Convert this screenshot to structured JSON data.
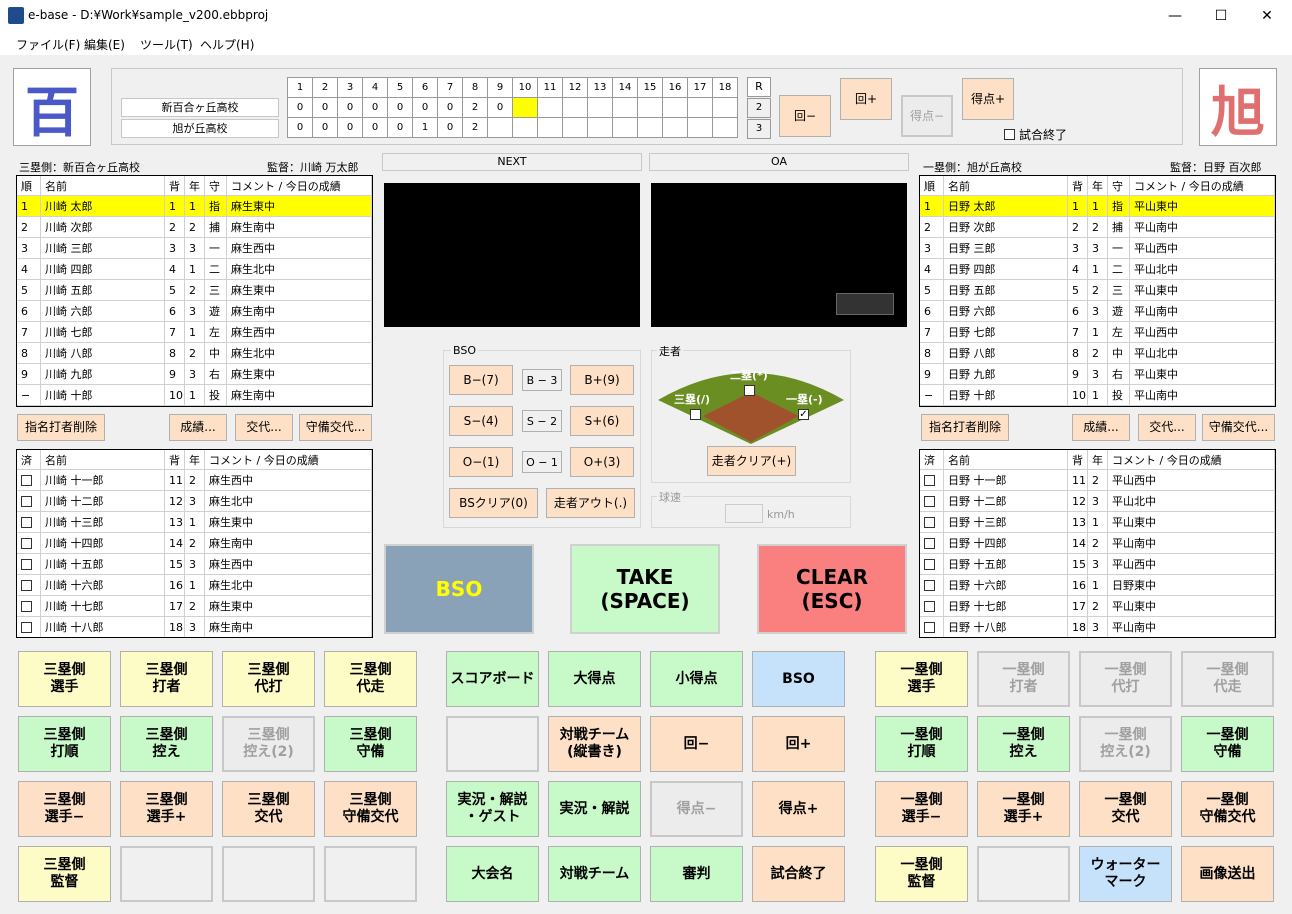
{
  "window": {
    "title": "e-base - D:¥Work¥sample_v200.ebbproj",
    "minimize": "—",
    "maximize": "☐",
    "close": "✕"
  },
  "menu": [
    "ファイル(F)",
    "編集(E)",
    "ツール(T)",
    "ヘルプ(H)"
  ],
  "logos": {
    "left": "百",
    "right": "旭",
    "left_color": "#4a58c8",
    "right_color": "#e07070"
  },
  "scoreboard": {
    "innings": [
      "1",
      "2",
      "3",
      "4",
      "5",
      "6",
      "7",
      "8",
      "9",
      "10",
      "11",
      "12",
      "13",
      "14",
      "15",
      "16",
      "17",
      "18"
    ],
    "r_label": "R",
    "teams": [
      {
        "name": "新百合ヶ丘高校",
        "scores": [
          "0",
          "0",
          "0",
          "0",
          "0",
          "0",
          "0",
          "2",
          "0",
          "",
          "",
          "",
          "",
          "",
          "",
          "",
          "",
          ""
        ],
        "r": "2"
      },
      {
        "name": "旭が丘高校",
        "scores": [
          "0",
          "0",
          "0",
          "0",
          "0",
          "1",
          "0",
          "2",
          "",
          "",
          "",
          "",
          "",
          "",
          "",
          "",
          "",
          ""
        ],
        "r": "3"
      }
    ],
    "current_cell": {
      "team": 0,
      "inning": 9
    },
    "btn_inning_minus": "回−",
    "btn_inning_plus": "回+",
    "btn_score_minus": "得点−",
    "btn_score_plus": "得点+",
    "game_end_label": "試合終了"
  },
  "left": {
    "side_label": "三塁側：新百合ヶ丘高校",
    "manager_label": "監督：川崎 万太郎",
    "headers": [
      "順",
      "名前",
      "背",
      "年",
      "守",
      "コメント / 今日の成績"
    ],
    "lineup": [
      [
        "1",
        "川崎 太郎",
        "1",
        "1",
        "指",
        "麻生東中"
      ],
      [
        "2",
        "川崎 次郎",
        "2",
        "2",
        "捕",
        "麻生南中"
      ],
      [
        "3",
        "川崎 三郎",
        "3",
        "3",
        "一",
        "麻生西中"
      ],
      [
        "4",
        "川崎 四郎",
        "4",
        "1",
        "二",
        "麻生北中"
      ],
      [
        "5",
        "川崎 五郎",
        "5",
        "2",
        "三",
        "麻生東中"
      ],
      [
        "6",
        "川崎 六郎",
        "6",
        "3",
        "遊",
        "麻生南中"
      ],
      [
        "7",
        "川崎 七郎",
        "7",
        "1",
        "左",
        "麻生西中"
      ],
      [
        "8",
        "川崎 八郎",
        "8",
        "2",
        "中",
        "麻生北中"
      ],
      [
        "9",
        "川崎 九郎",
        "9",
        "3",
        "右",
        "麻生東中"
      ],
      [
        "−",
        "川崎 十郎",
        "10",
        "1",
        "投",
        "麻生南中"
      ]
    ],
    "btn_dh": "指名打者削除",
    "btn_stats": "成績...",
    "btn_sub": "交代...",
    "btn_def": "守備交代...",
    "bench_headers": [
      "済",
      "名前",
      "背",
      "年",
      "コメント / 今日の成績"
    ],
    "bench": [
      [
        "川崎 十一郎",
        "11",
        "2",
        "麻生西中"
      ],
      [
        "川崎 十二郎",
        "12",
        "3",
        "麻生北中"
      ],
      [
        "川崎 十三郎",
        "13",
        "1",
        "麻生東中"
      ],
      [
        "川崎 十四郎",
        "14",
        "2",
        "麻生南中"
      ],
      [
        "川崎 十五郎",
        "15",
        "3",
        "麻生西中"
      ],
      [
        "川崎 十六郎",
        "16",
        "1",
        "麻生北中"
      ],
      [
        "川崎 十七郎",
        "17",
        "2",
        "麻生東中"
      ],
      [
        "川崎 十八郎",
        "18",
        "3",
        "麻生南中"
      ]
    ]
  },
  "right": {
    "side_label": "一塁側：旭が丘高校",
    "manager_label": "監督：日野 百次郎",
    "headers": [
      "順",
      "名前",
      "背",
      "年",
      "守",
      "コメント / 今日の成績"
    ],
    "lineup": [
      [
        "1",
        "日野 太郎",
        "1",
        "1",
        "指",
        "平山東中"
      ],
      [
        "2",
        "日野 次郎",
        "2",
        "2",
        "捕",
        "平山南中"
      ],
      [
        "3",
        "日野 三郎",
        "3",
        "3",
        "一",
        "平山西中"
      ],
      [
        "4",
        "日野 四郎",
        "4",
        "1",
        "二",
        "平山北中"
      ],
      [
        "5",
        "日野 五郎",
        "5",
        "2",
        "三",
        "平山東中"
      ],
      [
        "6",
        "日野 六郎",
        "6",
        "3",
        "遊",
        "平山南中"
      ],
      [
        "7",
        "日野 七郎",
        "7",
        "1",
        "左",
        "平山西中"
      ],
      [
        "8",
        "日野 八郎",
        "8",
        "2",
        "中",
        "平山北中"
      ],
      [
        "9",
        "日野 九郎",
        "9",
        "3",
        "右",
        "平山東中"
      ],
      [
        "−",
        "日野 十郎",
        "10",
        "1",
        "投",
        "平山南中"
      ]
    ],
    "btn_dh": "指名打者削除",
    "btn_stats": "成績...",
    "btn_sub": "交代...",
    "btn_def": "守備交代...",
    "bench_headers": [
      "済",
      "名前",
      "背",
      "年",
      "コメント / 今日の成績"
    ],
    "bench": [
      [
        "日野 十一郎",
        "11",
        "2",
        "平山西中"
      ],
      [
        "日野 十二郎",
        "12",
        "3",
        "平山北中"
      ],
      [
        "日野 十三郎",
        "13",
        "1",
        "平山東中"
      ],
      [
        "日野 十四郎",
        "14",
        "2",
        "平山南中"
      ],
      [
        "日野 十五郎",
        "15",
        "3",
        "平山西中"
      ],
      [
        "日野 十六郎",
        "16",
        "1",
        "日野東中"
      ],
      [
        "日野 十七郎",
        "17",
        "2",
        "平山東中"
      ],
      [
        "日野 十八郎",
        "18",
        "3",
        "平山南中"
      ]
    ]
  },
  "preview": {
    "next": "NEXT",
    "oa": "OA"
  },
  "bso": {
    "group_label": "BSO",
    "b_minus": "B−(7)",
    "b_count": "B − 3",
    "b_plus": "B+(9)",
    "s_minus": "S−(4)",
    "s_count": "S − 2",
    "s_plus": "S+(6)",
    "o_minus": "O−(1)",
    "o_count": "O − 1",
    "o_plus": "O+(3)",
    "clear": "BSクリア(0)",
    "runner_out": "走者アウト(.)"
  },
  "runner": {
    "group_label": "走者",
    "second": "二塁(*)",
    "third": "三塁(/)",
    "first": "一塁(-)",
    "clear": "走者クリア(+)",
    "speed_label": "球速",
    "speed_unit": "km/h",
    "speed_value": ""
  },
  "main_buttons": {
    "bso": "BSO",
    "take": "TAKE\n(SPACE)",
    "clear": "CLEAR\n(ESC)"
  },
  "grid_buttons": {
    "l_player": "三塁側\n選手",
    "l_batter": "三塁側\n打者",
    "l_pinch": "三塁側\n代打",
    "l_runner": "三塁側\n代走",
    "l_order": "三塁側\n打順",
    "l_bench": "三塁側\n控え",
    "l_bench2": "三塁側\n控え(2)",
    "l_def": "三塁側\n守備",
    "l_pm": "三塁側\n選手−",
    "l_pp": "三塁側\n選手+",
    "l_sub": "三塁側\n交代",
    "l_defsub": "三塁側\n守備交代",
    "l_mgr": "三塁側\n監督",
    "scoreboard": "スコアボード",
    "big_score": "大得点",
    "small_score": "小得点",
    "bso": "BSO",
    "match_v": "対戦チーム\n(縦書き)",
    "inn_minus": "回−",
    "inn_plus": "回+",
    "commentary_guest": "実況・解説\n・ゲスト",
    "commentary": "実況・解説",
    "score_minus": "得点−",
    "score_plus": "得点+",
    "tournament": "大会名",
    "match": "対戦チーム",
    "umpire": "審判",
    "game_end": "試合終了",
    "r_player": "一塁側\n選手",
    "r_batter": "一塁側\n打者",
    "r_pinch": "一塁側\n代打",
    "r_runner": "一塁側\n代走",
    "r_order": "一塁側\n打順",
    "r_bench": "一塁側\n控え",
    "r_bench2": "一塁側\n控え(2)",
    "r_def": "一塁側\n守備",
    "r_pm": "一塁側\n選手−",
    "r_pp": "一塁側\n選手+",
    "r_sub": "一塁側\n交代",
    "r_defsub": "一塁側\n守備交代",
    "r_mgr": "一塁側\n監督",
    "watermark": "ウォーター\nマーク",
    "send_image": "画像送出"
  }
}
